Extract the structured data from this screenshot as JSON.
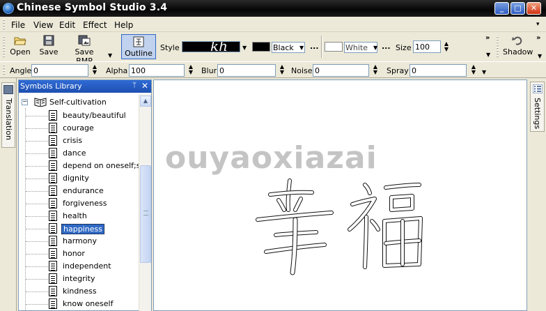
{
  "window": {
    "title": "Chinese Symbol Studio 3.4"
  },
  "menu": {
    "file": "File",
    "view": "View",
    "edit": "Edit",
    "effect": "Effect",
    "help": "Help"
  },
  "toolbar": {
    "open": "Open",
    "save": "Save",
    "save_bmp": "Save BMP",
    "outline": "Outline",
    "style_label": "Style",
    "style_preview": "kh",
    "text_color": "Black",
    "bg_color": "White",
    "more": "...",
    "size_label": "Size",
    "size_value": "100",
    "shadow": "Shadow"
  },
  "effects": {
    "angle": {
      "label": "Angle",
      "value": "0"
    },
    "alpha": {
      "label": "Alpha",
      "value": "100"
    },
    "blur": {
      "label": "Blur",
      "value": "0"
    },
    "noise": {
      "label": "Noise",
      "value": "0"
    },
    "spray": {
      "label": "Spray",
      "value": "0"
    }
  },
  "docks": {
    "translation": "Translation",
    "settings": "Settings"
  },
  "library": {
    "title": "Symbols Library",
    "category": "Self-cultivation",
    "items": [
      "beauty/beautiful",
      "courage",
      "crisis",
      "dance",
      "depend on oneself;sta",
      "dignity",
      "endurance",
      "forgiveness",
      "health",
      "happiness",
      "harmony",
      "honor",
      "independent",
      "integrity",
      "kindness",
      "know oneself"
    ],
    "selected": "happiness"
  },
  "canvas": {
    "watermark": "ouyaoxiazai",
    "characters": "幸福"
  },
  "colors": {
    "selection": "#316ac5",
    "panel_header": "#2f6bd6",
    "chrome": "#ece9d8"
  }
}
